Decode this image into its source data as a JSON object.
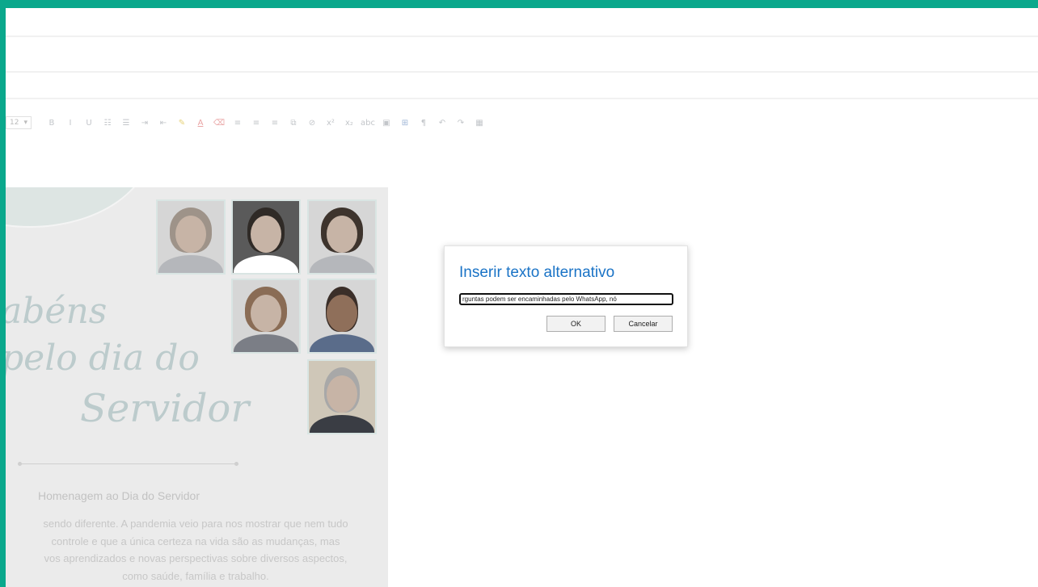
{
  "toolbar": {
    "font_size": "12",
    "buttons": [
      {
        "icon": "B",
        "name": "bold"
      },
      {
        "icon": "I",
        "name": "italic"
      },
      {
        "icon": "U",
        "name": "underline"
      },
      {
        "icon": "☷",
        "name": "bullet-list"
      },
      {
        "icon": "☰",
        "name": "numbered-list"
      },
      {
        "icon": "⇥",
        "name": "indent"
      },
      {
        "icon": "⇤",
        "name": "outdent"
      },
      {
        "icon": "✎",
        "name": "highlight"
      },
      {
        "icon": "A",
        "name": "font-color"
      },
      {
        "icon": "⌫",
        "name": "clear-format"
      },
      {
        "icon": "≡",
        "name": "align-left"
      },
      {
        "icon": "≡",
        "name": "align-center"
      },
      {
        "icon": "≡",
        "name": "align-right"
      },
      {
        "icon": "⧉",
        "name": "link"
      },
      {
        "icon": "⊘",
        "name": "unlink"
      },
      {
        "icon": "x²",
        "name": "superscript"
      },
      {
        "icon": "x₂",
        "name": "subscript"
      },
      {
        "icon": "abc",
        "name": "strikethrough"
      },
      {
        "icon": "▣",
        "name": "image"
      },
      {
        "icon": "⊞",
        "name": "alt-text"
      },
      {
        "icon": "¶",
        "name": "ltr"
      },
      {
        "icon": "↶",
        "name": "undo"
      },
      {
        "icon": "↷",
        "name": "redo"
      },
      {
        "icon": "▦",
        "name": "table"
      }
    ]
  },
  "content": {
    "script_line1": "abéns",
    "script_line2": "pelo dia do",
    "script_line3": "Servidor",
    "subtitle": "Homenagem ao Dia do Servidor",
    "body_lines": [
      "sendo diferente. A pandemia veio para nos mostrar que nem tudo",
      "controle e que a única certeza na vida são as mudanças, mas",
      "vos aprendizados e novas perspectivas sobre diversos aspectos,",
      "como saúde, família e trabalho."
    ]
  },
  "dialog": {
    "title": "Inserir texto alternativo",
    "input_value": "rguntas podem ser encaminhadas pelo WhatsApp, nó",
    "ok_label": "OK",
    "cancel_label": "Cancelar"
  },
  "colors": {
    "frame": "#0aa88c",
    "dialog_title": "#1a73c6"
  }
}
